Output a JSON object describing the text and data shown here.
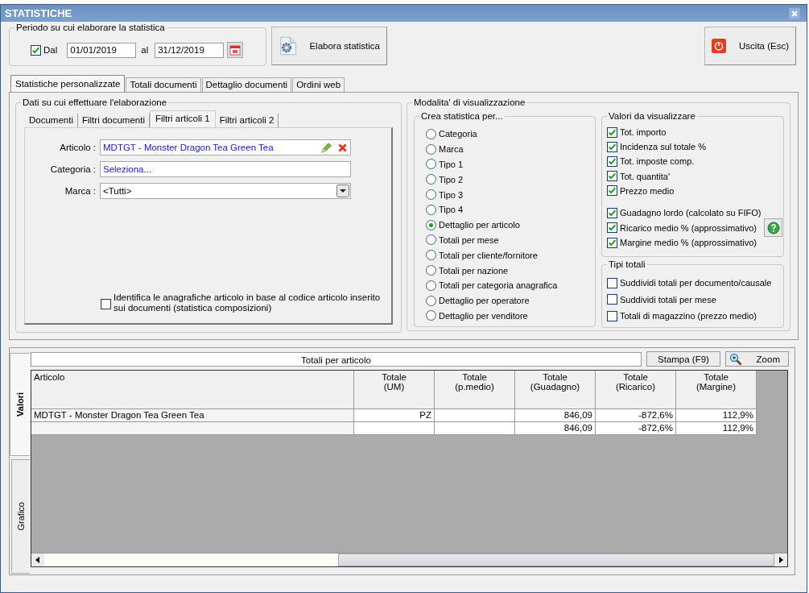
{
  "window": {
    "title": "STATISTICHE"
  },
  "period": {
    "legend": "Periodo su cui elaborare la statistica",
    "from_check": {
      "label": "Dal",
      "checked": true
    },
    "from": "01/01/2019",
    "to_label": "al",
    "to": "31/12/2019"
  },
  "buttons": [
    {
      "label": "Elabora statistica",
      "kind": "process"
    },
    {
      "label": "Uscita (Esc)",
      "kind": "exit"
    }
  ],
  "tabs": [
    {
      "label": "Statistiche personalizzate",
      "selected": true
    },
    {
      "label": "Totali documenti",
      "selected": false
    },
    {
      "label": "Dettaglio documenti",
      "selected": false
    },
    {
      "label": "Ordini web",
      "selected": false
    }
  ],
  "data_group": {
    "legend": "Dati su cui effettuare l'elaborazione",
    "tabs": [
      {
        "label": "Documenti",
        "selected": false
      },
      {
        "label": "Filtri documenti",
        "selected": false
      },
      {
        "label": "Filtri articoli 1",
        "selected": true
      },
      {
        "label": "Filtri articoli 2",
        "selected": false
      }
    ],
    "fields": [
      {
        "label": "Articolo :",
        "value": "MDTGT - Monster Dragon Tea Green Tea",
        "kind": "picker"
      },
      {
        "label": "Categoria :",
        "value": "Seleziona...",
        "kind": "link"
      },
      {
        "label": "Marca :",
        "value": "<Tutti>",
        "kind": "dropdown"
      }
    ],
    "option": {
      "label": "Identifica le anagrafiche articolo in base al codice articolo inserito sui documenti (statistica composizioni)",
      "checked": false
    }
  },
  "display": {
    "legend": "Modalita' di visualizzazione",
    "group_by": {
      "legend": "Crea statistica per...",
      "options": [
        {
          "label": "Categoria",
          "selected": false
        },
        {
          "label": "Marca",
          "selected": false
        },
        {
          "label": "Tipo 1",
          "selected": false
        },
        {
          "label": "Tipo 2",
          "selected": false
        },
        {
          "label": "Tipo 3",
          "selected": false
        },
        {
          "label": "Tipo 4",
          "selected": false
        },
        {
          "label": "Dettaglio per articolo",
          "selected": true
        },
        {
          "label": "Totali per mese",
          "selected": false
        },
        {
          "label": "Totali per cliente/fornitore",
          "selected": false
        },
        {
          "label": "Totali per nazione",
          "selected": false
        },
        {
          "label": "Totali per categoria anagrafica",
          "selected": false
        },
        {
          "label": "Dettaglio per operatore",
          "selected": false
        },
        {
          "label": "Dettaglio per venditore",
          "selected": false
        }
      ]
    },
    "values": {
      "legend": "Valori da visualizzare",
      "items": [
        {
          "label": "Tot. importo",
          "checked": true
        },
        {
          "label": "Incidenza sul totale %",
          "checked": true
        },
        {
          "label": "Tot. imposte comp.",
          "checked": true
        },
        {
          "label": "Tot. quantita'",
          "checked": true
        },
        {
          "label": "Prezzo medio",
          "checked": true
        }
      ],
      "profit_items": [
        {
          "label": "Guadagno lordo (calcolato su FIFO)",
          "checked": true
        },
        {
          "label": "Ricarico medio % (approssimativo)",
          "checked": true
        },
        {
          "label": "Margine medio % (approssimativo)",
          "checked": true
        }
      ]
    },
    "totals": {
      "legend": "Tipi totali",
      "items": [
        {
          "label": "Suddividi totali per documento/causale",
          "checked": false
        },
        {
          "label": "Suddividi totali per mese",
          "checked": false
        },
        {
          "label": "Totali di magazzino (prezzo medio)",
          "checked": false
        }
      ]
    }
  },
  "results": {
    "side_tabs": [
      {
        "label": "Valori",
        "selected": true
      },
      {
        "label": "Grafico",
        "selected": false
      }
    ],
    "title": "Totali per articolo",
    "actions": [
      {
        "label": "Stampa (F9)",
        "kind": "print"
      },
      {
        "label": "Zoom",
        "kind": "zoom"
      }
    ],
    "table": {
      "columns": [
        {
          "label": "Articolo"
        },
        {
          "label": "Totale\n(UM)"
        },
        {
          "label": "Totale\n(p.medio)"
        },
        {
          "label": "Totale\n(Guadagno)"
        },
        {
          "label": "Totale\n(Ricarico)"
        },
        {
          "label": "Totale\n(Margine)"
        }
      ],
      "rows": [
        [
          "MDTGT - Monster Dragon Tea Green Tea",
          "PZ",
          null,
          "846,09",
          "-872,6%",
          "112,9%"
        ],
        [
          null,
          null,
          null,
          "846,09",
          "-872,6%",
          "112,9%"
        ]
      ]
    }
  }
}
